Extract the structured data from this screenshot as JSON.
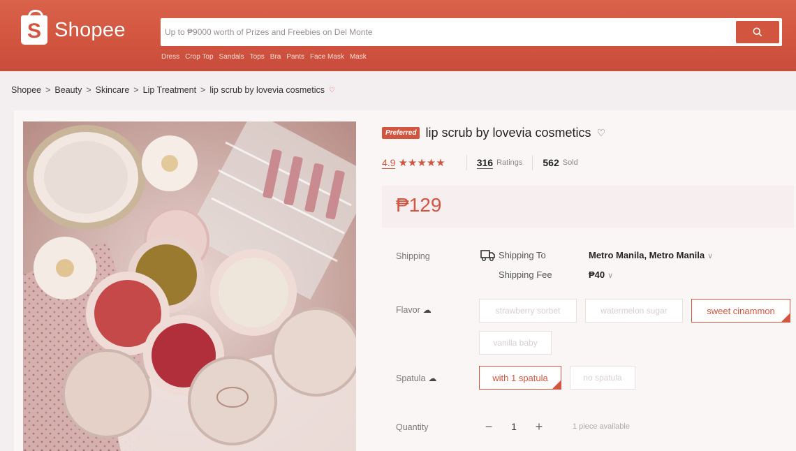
{
  "header": {
    "logo_letter": "S",
    "logo_text": "Shopee",
    "search_placeholder": "Up to ₱9000 worth of Prizes and Freebies on Del Monte",
    "suggestions": [
      "Dress",
      "Crop Top",
      "Sandals",
      "Tops",
      "Bra",
      "Pants",
      "Face Mask",
      "Mask"
    ]
  },
  "breadcrumb": [
    "Shopee",
    "Beauty",
    "Skincare",
    "Lip Treatment",
    "lip scrub by lovevia cosmetics"
  ],
  "product": {
    "badge": "Preferred",
    "title": "lip scrub by lovevia cosmetics",
    "rating": "4.9",
    "stars": "★★★★★",
    "ratings_count": "316",
    "ratings_label": "Ratings",
    "sold_count": "562",
    "sold_label": "Sold",
    "price": "₱129"
  },
  "shipping": {
    "label": "Shipping",
    "to_label": "Shipping To",
    "fee_label": "Shipping Fee",
    "location": "Metro Manila, Metro Manila",
    "fee": "₱40"
  },
  "flavor": {
    "label": "Flavor",
    "options": [
      "strawberry sorbet",
      "watermelon sugar",
      "sweet cinammon",
      "vanilla baby"
    ],
    "selected": "sweet cinammon"
  },
  "spatula": {
    "label": "Spatula",
    "options": [
      "with 1 spatula",
      "no spatula"
    ],
    "selected": "with 1 spatula"
  },
  "quantity": {
    "label": "Quantity",
    "minus": "−",
    "value": "1",
    "plus": "+",
    "available": "1 piece available"
  },
  "colors": {
    "brand": "#d2553f"
  }
}
